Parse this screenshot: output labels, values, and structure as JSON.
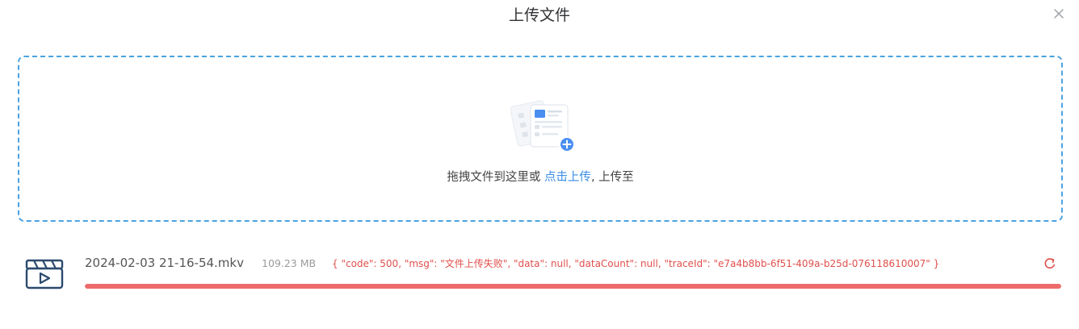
{
  "dialog": {
    "title": "上传文件"
  },
  "dropzone": {
    "text_before": "拖拽文件到这里或 ",
    "link_text": "点击上传",
    "text_after": ", 上传至"
  },
  "upload_list": [
    {
      "file_name": "2024-02-03 21-16-54.mkv",
      "file_size": "109.23 MB",
      "status": "error",
      "error_message": "{ \"code\": 500, \"msg\": \"文件上传失败\", \"data\": null, \"dataCount\": null, \"traceId\": \"e7a4b8bb-6f51-409a-b25d-076118610007\" }",
      "progress": 1.0
    }
  ],
  "icons": {
    "close": "close-icon",
    "upload_illustration": "document-upload-illustration",
    "file": "video-file-icon",
    "retry": "refresh-icon"
  },
  "colors": {
    "accent": "#3a8ee6",
    "dropzone_border": "#4aa3e0",
    "error": "#e0504c",
    "progress_error": "#ee6b6b"
  }
}
